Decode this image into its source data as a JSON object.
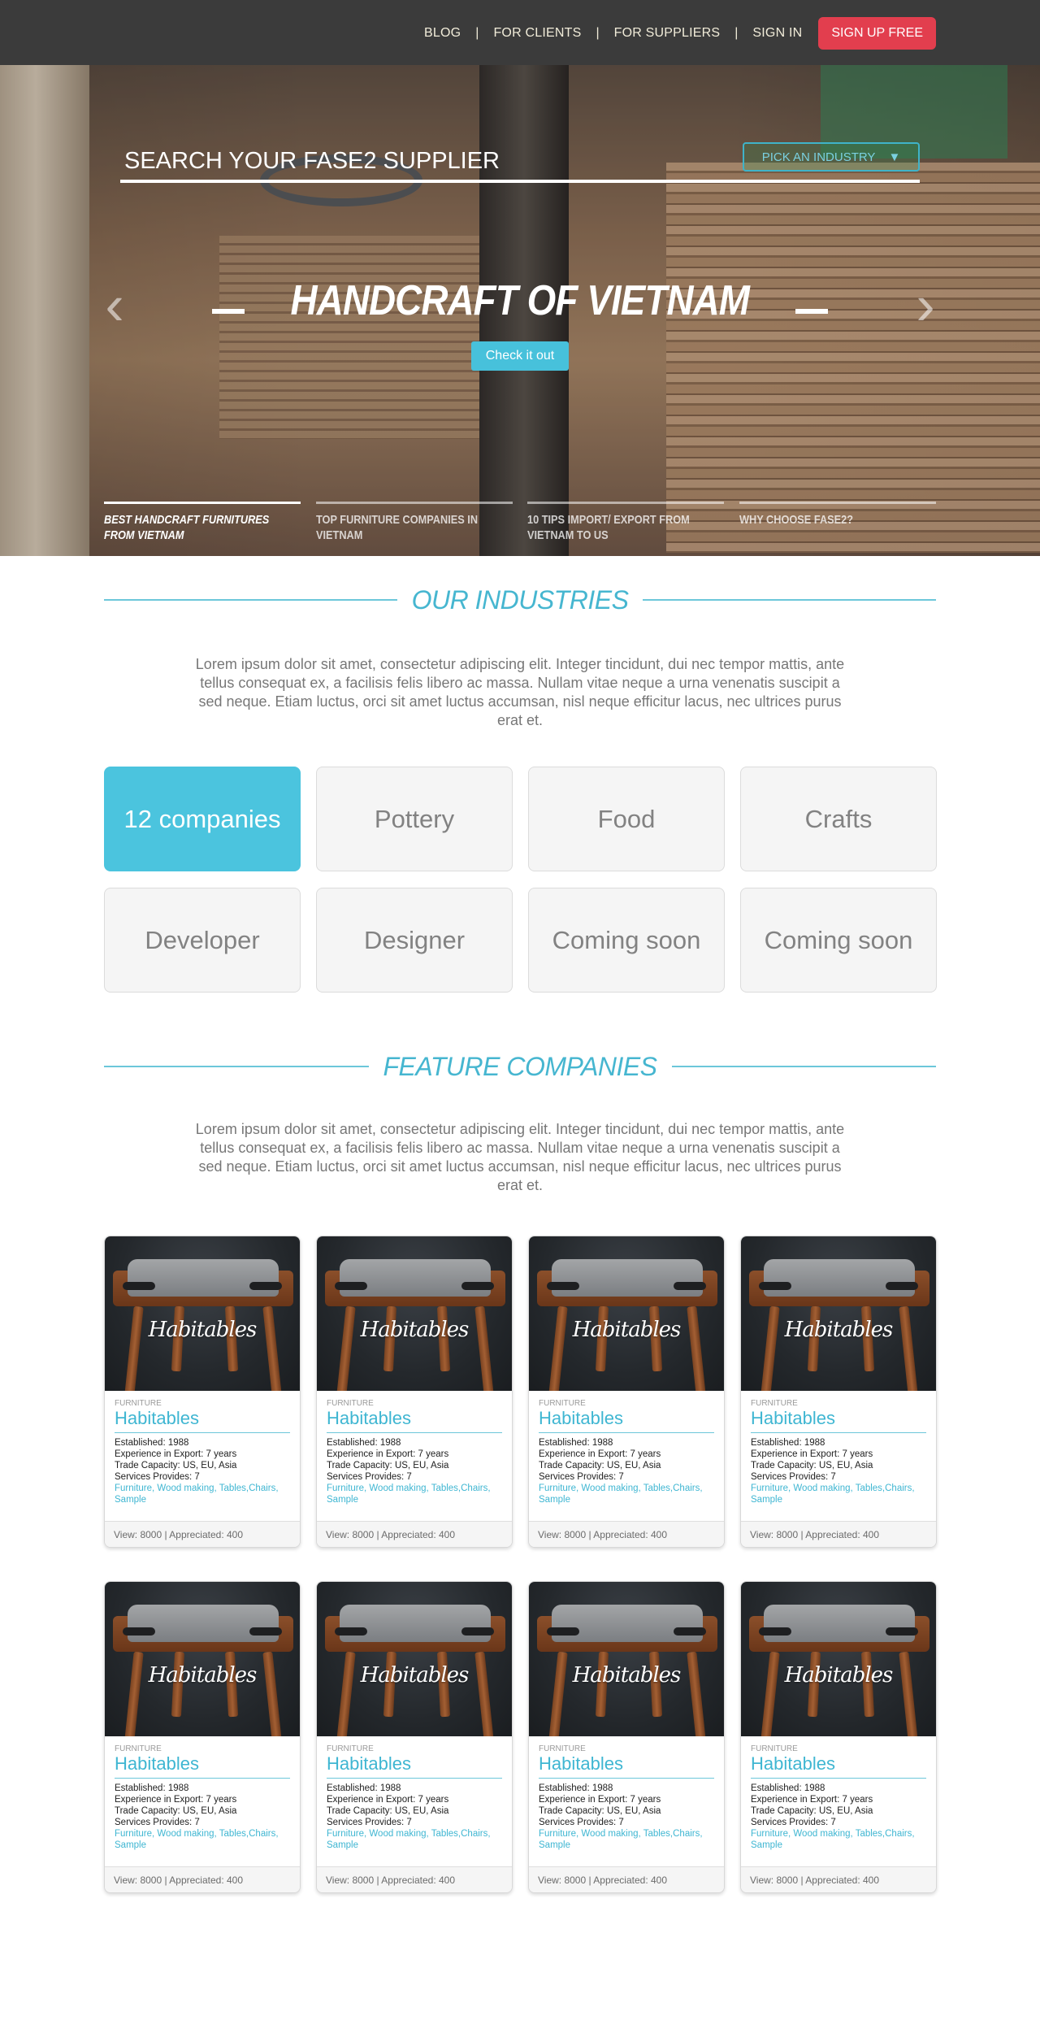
{
  "nav": {
    "items": [
      "BLOG",
      "FOR CLIENTS",
      "FOR SUPPLIERS",
      "SIGN IN"
    ],
    "separator": "|",
    "signup_label": "SIGN UP FREE"
  },
  "hero": {
    "search_placeholder": "SEARCH YOUR FASE2 SUPPLIER",
    "industry_select": "PICK AN INDUSTRY",
    "arrow_glyph": "▼",
    "prev_glyph": "‹",
    "next_glyph": "›",
    "title": "HANDCRAFT OF VIETNAM",
    "cta_label": "Check it out",
    "slides": [
      {
        "text": "BEST HANDCRAFT FURNITURES FROM VIETNAM",
        "active": true
      },
      {
        "text": "TOP FURNITURE COMPANIES IN VIETNAM",
        "active": false
      },
      {
        "text": "10 TIPS IMPORT/ EXPORT FROM VIETNAM TO US",
        "active": false
      },
      {
        "text": "WHY CHOOSE FASE2?",
        "active": false
      }
    ]
  },
  "industries": {
    "heading": "OUR INDUSTRIES",
    "description": "Lorem ipsum dolor sit amet, consectetur adipiscing elit. Integer tincidunt, dui nec tempor mattis, ante tellus consequat ex, a facilisis felis libero ac massa. Nullam vitae neque a urna venenatis suscipit a sed neque. Etiam luctus, orci sit amet luctus accumsan, nisl neque efficitur lacus, nec ultrices purus erat et.",
    "tiles": [
      {
        "label": "12 companies",
        "active": true
      },
      {
        "label": "Pottery",
        "active": false
      },
      {
        "label": "Food",
        "active": false
      },
      {
        "label": "Crafts",
        "active": false
      },
      {
        "label": "Developer",
        "active": false
      },
      {
        "label": "Designer",
        "active": false
      },
      {
        "label": "Coming soon",
        "active": false
      },
      {
        "label": "Coming soon",
        "active": false
      }
    ]
  },
  "features": {
    "heading": "FEATURE COMPANIES",
    "description": "Lorem ipsum dolor sit amet, consectetur adipiscing elit. Integer tincidunt, dui nec tempor mattis, ante tellus consequat ex, a facilisis felis libero ac massa. Nullam vitae neque a urna venenatis suscipit a sed neque. Etiam luctus, orci sit amet luctus accumsan, nisl neque efficitur lacus, nec ultrices purus erat et.",
    "card_template": {
      "logo": "Habitables",
      "category": "FURNITURE",
      "name": "Habitables",
      "established": "Established: 1988",
      "experience": "Experience in Export: 7 years",
      "trade": "Trade Capacity: US, EU, Asia",
      "services": "Services Provides: 7",
      "tags": "Furniture, Wood making, Tables,Chairs, Sample",
      "stats": "View: 8000 | Appreciated: 400"
    },
    "card_count": 8
  },
  "colors": {
    "accent": "#47c1db",
    "signup": "#e23e4e",
    "topbar": "#3b3b3b"
  }
}
